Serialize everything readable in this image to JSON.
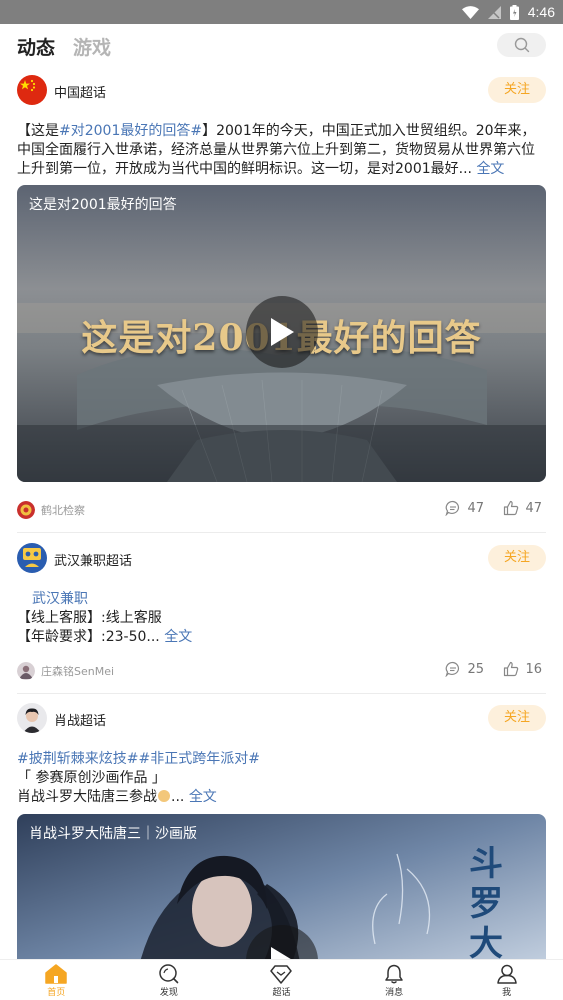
{
  "status_bar": {
    "time": "4:46"
  },
  "header": {
    "tabs": [
      {
        "label": "动态",
        "active": true
      },
      {
        "label": "游戏",
        "active": false
      }
    ]
  },
  "posts": [
    {
      "group": "中国超话",
      "follow_label": "关注",
      "text_prefix": "【这是",
      "topic": "#对2001最好的回答#",
      "text_body": "】2001年的今天，中国正式加入世贸组织。20年来，中国全面履行入世承诺，经济总量从世界第六位上升到第二，货物贸易从世界第六位上升到第一位，开放成为当代中国的鲜明标识。这一切，是对2001最好...",
      "more_label": "全文",
      "video_title": "这是对2001最好的回答",
      "video_overlay": "这是对2001最好的回答",
      "author": "鹤北检察",
      "comments": "47",
      "likes": "47"
    },
    {
      "group": "武汉兼职超话",
      "follow_label": "关注",
      "tag": "武汉兼职",
      "line1": "【线上客服】:线上客服",
      "line2": "【年龄要求】:23-50...",
      "more_label": "全文",
      "author": "庄森铭SenMei",
      "comments": "25",
      "likes": "16"
    },
    {
      "group": "肖战超话",
      "follow_label": "关注",
      "topics": "#披荆斩棘来炫技##非正式跨年派对#",
      "line1": "「 参赛原创沙画作品 」",
      "line2": "肖战斗罗大陆唐三参战",
      "more_label": "全文",
      "video_title": "肖战斗罗大陆唐三｜沙画版",
      "video_calligraphy": "斗罗大"
    }
  ],
  "bottom_nav": [
    {
      "label": "首页",
      "icon": "home-icon",
      "active": true
    },
    {
      "label": "发现",
      "icon": "discover-icon",
      "active": false
    },
    {
      "label": "超话",
      "icon": "diamond-icon",
      "active": false
    },
    {
      "label": "消息",
      "icon": "bell-icon",
      "active": false
    },
    {
      "label": "我",
      "icon": "person-icon",
      "active": false
    }
  ],
  "colors": {
    "accent": "#f5a623",
    "follow_bg": "#fdf0dc",
    "link": "#4a76b5",
    "status_bar": "#7f7f7f"
  }
}
